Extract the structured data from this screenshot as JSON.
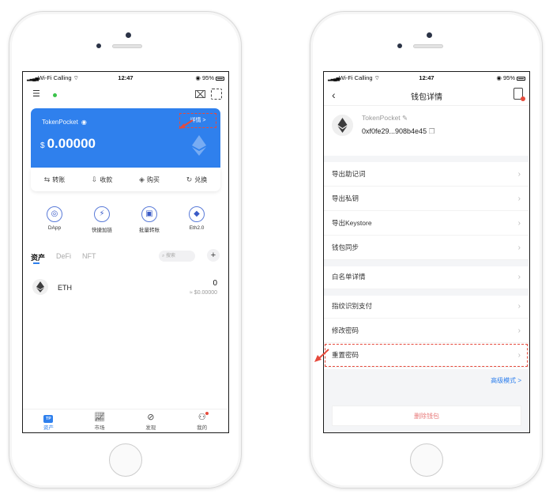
{
  "status_bar": {
    "carrier": "Wi-Fi Calling",
    "time": "12:47",
    "battery": "95%"
  },
  "left": {
    "wallet_name": "TokenPocket",
    "currency_symbol": "$",
    "balance": "0.00000",
    "detail_link": "详情 >",
    "actions": [
      {
        "icon": "transfer-icon",
        "label": "转账"
      },
      {
        "icon": "receive-icon",
        "label": "收款"
      },
      {
        "icon": "buy-icon",
        "label": "购买"
      },
      {
        "icon": "exchange-icon",
        "label": "兑换"
      }
    ],
    "shortcuts": [
      {
        "icon": "compass-icon",
        "label": "DApp"
      },
      {
        "icon": "bridge-icon",
        "label": "快捷加链"
      },
      {
        "icon": "batch-icon",
        "label": "批量转账"
      },
      {
        "icon": "eth2-icon",
        "label": "Eth2.0"
      }
    ],
    "tabs": [
      "资产",
      "DeFi",
      "NFT"
    ],
    "search_placeholder": "搜索",
    "assets": [
      {
        "symbol": "ETH",
        "amount": "0",
        "fiat": "≈ $0.00000"
      }
    ],
    "bottom_nav": [
      {
        "icon": "tp-icon",
        "label": "资产"
      },
      {
        "icon": "market-icon",
        "label": "市场"
      },
      {
        "icon": "discover-icon",
        "label": "发现"
      },
      {
        "icon": "profile-icon",
        "label": "我的"
      }
    ],
    "accent_color": "#2f80ed"
  },
  "right": {
    "title": "钱包详情",
    "wallet_name": "TokenPocket",
    "address": "0xf0fe29...908b4e45",
    "menu_group1": [
      "导出助记词",
      "导出私钥",
      "导出Keystore",
      "钱包同步"
    ],
    "menu_group2": [
      "白名单详情"
    ],
    "menu_group3": [
      "指纹识别支付",
      "修改密码",
      "重置密码"
    ],
    "advanced_link": "高级模式 >",
    "delete_button": "删除钱包",
    "highlight_color": "#e64a3c"
  }
}
